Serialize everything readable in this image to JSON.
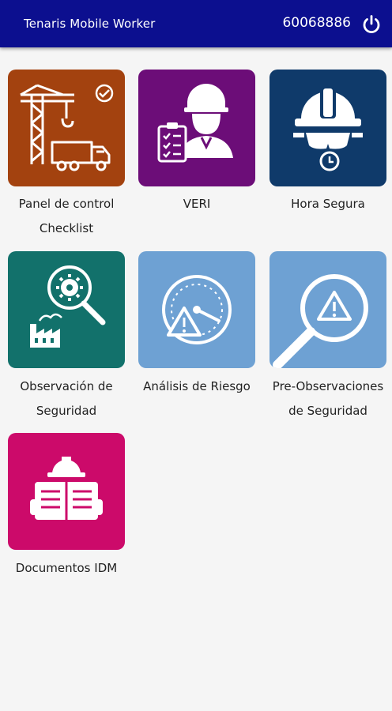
{
  "header": {
    "app_title": "Tenaris Mobile Worker",
    "user_id": "60068886"
  },
  "tiles": [
    {
      "label": "Panel de control Checklist",
      "color": "#a3420f"
    },
    {
      "label": "VERI",
      "color": "#6c0d78"
    },
    {
      "label": "Hora Segura",
      "color": "#0f3a6a"
    },
    {
      "label": "Observación de Seguridad",
      "color": "#12716b"
    },
    {
      "label": "Análisis de Riesgo",
      "color": "#6ea1d3"
    },
    {
      "label": "Pre-Observaciones de Seguridad",
      "color": "#6ea1d3"
    },
    {
      "label": "Documentos IDM",
      "color": "#cc0a6a"
    }
  ],
  "icons": [
    "crane-truck-check-icon",
    "inspector-clipboard-icon",
    "hardhat-clock-icon",
    "gear-magnifier-factory-icon",
    "gauge-warning-icon",
    "magnifier-warning-icon",
    "worker-document-icon"
  ]
}
